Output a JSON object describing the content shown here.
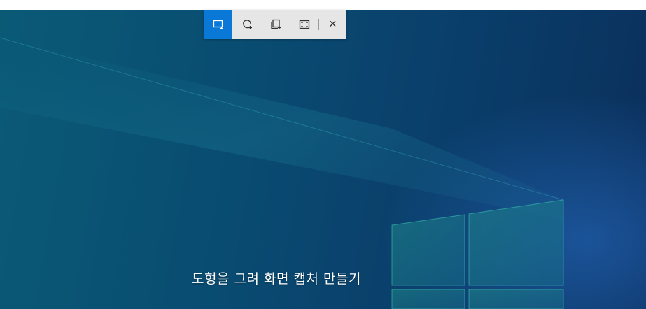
{
  "toolbar": {
    "buttons": [
      {
        "id": "rectangle",
        "icon": "rectangle-snip-icon",
        "active": true
      },
      {
        "id": "freeform",
        "icon": "freeform-snip-icon",
        "active": false
      },
      {
        "id": "window",
        "icon": "window-snip-icon",
        "active": false
      },
      {
        "id": "fullscreen",
        "icon": "fullscreen-snip-icon",
        "active": false
      }
    ],
    "close_label": "✕",
    "active_color": "#0a78d7"
  },
  "hint": {
    "text": "도형을 그려 화면 캡처 만들기"
  }
}
